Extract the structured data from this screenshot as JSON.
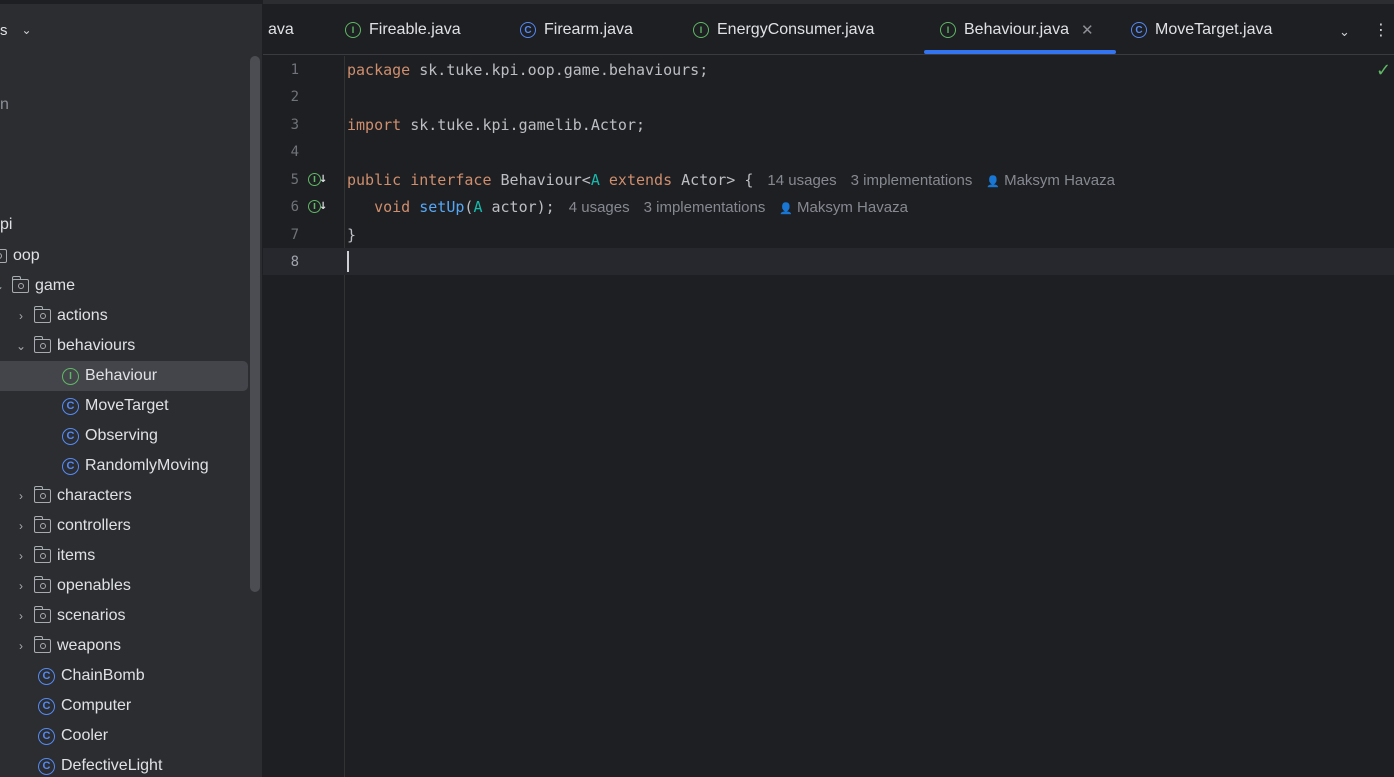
{
  "sidebar": {
    "header_fragment": "s",
    "frag_n": "n",
    "frag_pi": "pi",
    "rows": [
      {
        "label": "oop"
      },
      {
        "label": "game"
      },
      {
        "label": "actions"
      },
      {
        "label": "behaviours"
      },
      {
        "label": "Behaviour",
        "icon": "I"
      },
      {
        "label": "MoveTarget",
        "icon": "C"
      },
      {
        "label": "Observing",
        "icon": "C"
      },
      {
        "label": "RandomlyMoving",
        "icon": "C"
      },
      {
        "label": "characters"
      },
      {
        "label": "controllers"
      },
      {
        "label": "items"
      },
      {
        "label": "openables"
      },
      {
        "label": "scenarios"
      },
      {
        "label": "weapons"
      },
      {
        "label": "ChainBomb",
        "icon": "C"
      },
      {
        "label": "Computer",
        "icon": "C"
      },
      {
        "label": "Cooler",
        "icon": "C"
      },
      {
        "label": "DefectiveLight",
        "icon": "C"
      }
    ]
  },
  "tabs": [
    {
      "label": "ava",
      "icon": "none"
    },
    {
      "label": "Fireable.java",
      "icon": "I"
    },
    {
      "label": "Firearm.java",
      "icon": "C"
    },
    {
      "label": "EnergyConsumer.java",
      "icon": "I"
    },
    {
      "label": "Behaviour.java",
      "icon": "I",
      "active": true
    },
    {
      "label": "MoveTarget.java",
      "icon": "C"
    }
  ],
  "editor": {
    "line_numbers": [
      "1",
      "2",
      "3",
      "4",
      "5",
      "6",
      "7",
      "8"
    ],
    "line1": {
      "kw": "package",
      "rest": " sk.tuke.kpi.oop.game.behaviours;"
    },
    "line3": {
      "kw": "import",
      "rest": " sk.tuke.kpi.gamelib.Actor;"
    },
    "line5": {
      "kw1": "public interface",
      "name": " Behaviour<",
      "tp": "A",
      "kw2": " extends",
      "rest": " Actor> {"
    },
    "line5_hints": {
      "usages": "14 usages",
      "impls": "3 implementations",
      "author": "Maksym Havaza"
    },
    "line6": {
      "kw": "void",
      "fn": "setUp",
      "open": "(",
      "tp": "A",
      "rest": " actor);"
    },
    "line6_hints": {
      "usages": "4 usages",
      "impls": "3 implementations",
      "author": "Maksym Havaza"
    },
    "line7": "}"
  },
  "colors": {
    "keyword": "#cf8e6d",
    "type_param": "#16baac",
    "function": "#56a8f5",
    "interface_icon": "#5fb865",
    "class_icon": "#548af7",
    "accent": "#3574f0"
  }
}
